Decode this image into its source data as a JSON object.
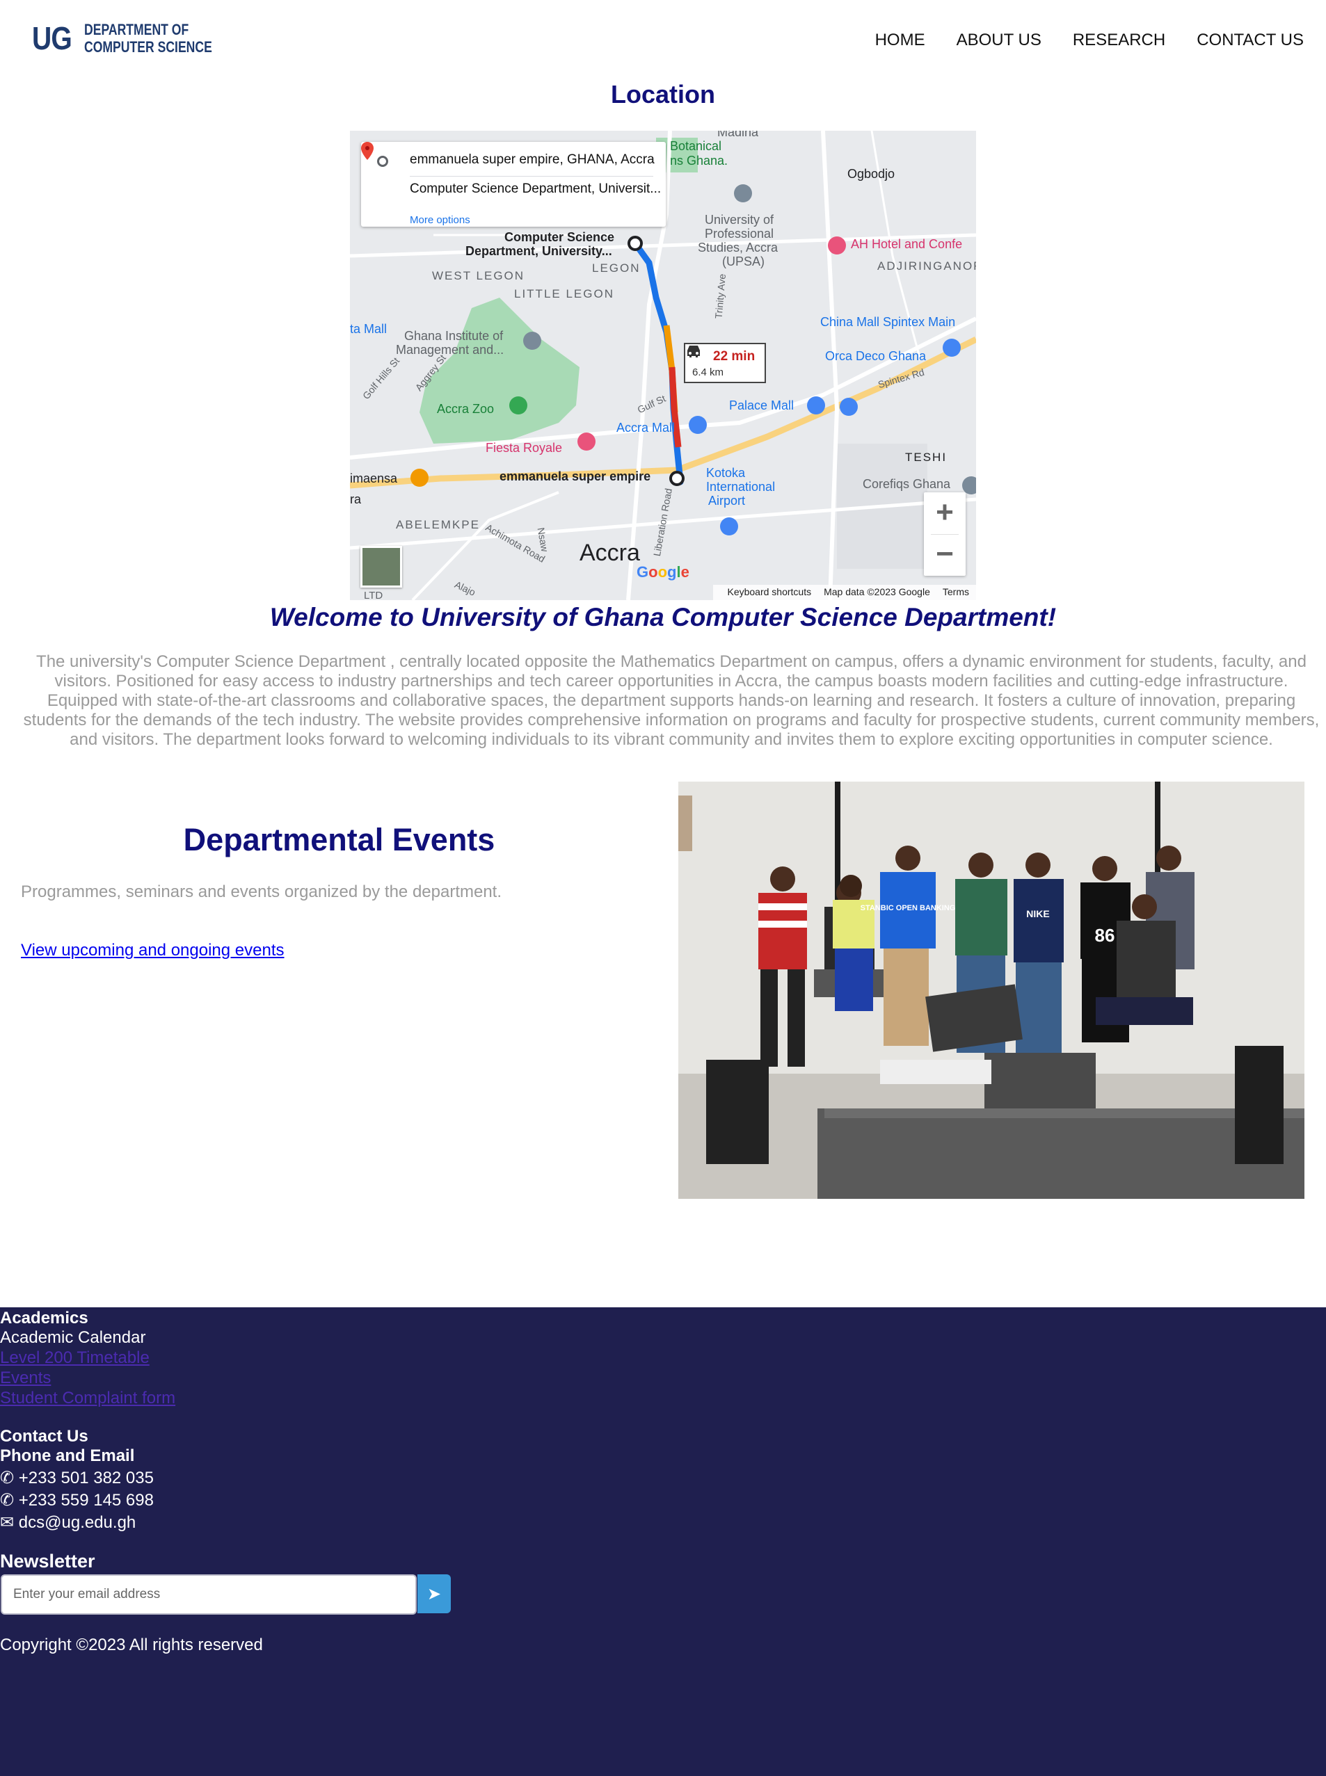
{
  "header": {
    "logo_short": "UG",
    "logo_line1": "DEPARTMENT OF",
    "logo_line2": "COMPUTER SCIENCE",
    "nav": [
      {
        "label": "HOME"
      },
      {
        "label": "ABOUT US"
      },
      {
        "label": "RESEARCH"
      },
      {
        "label": "CONTACT US"
      }
    ]
  },
  "location": {
    "title": "Location",
    "map": {
      "origin": "emmanuela super empire, GHANA, Accra",
      "destination": "Computer Science Department, Universit...",
      "more_options": "More options",
      "travel_time": "22 min",
      "distance": "6.4 km",
      "labels": {
        "madina": "Madina",
        "botanical": "Botanical",
        "botanical2": "ns Ghana.",
        "ogbodjo": "Ogbodjo",
        "upsa1": "University of",
        "upsa2": "Professional",
        "upsa3": "Studies, Accra",
        "upsa4": "(UPSA)",
        "ah_hotel": "AH Hotel and Confe",
        "adjiringanor": "ADJIRINGANOR",
        "csd1": "Computer Science",
        "csd2": "Department, University...",
        "legon": "LEGON",
        "west_legon": "WEST LEGON",
        "little_legon": "LITTLE LEGON",
        "ta_mall": "ta Mall",
        "gimpa1": "Ghana Institute of",
        "gimpa2": "Management and...",
        "china_mall": "China Mall Spintex Main",
        "orca": "Orca Deco Ghana",
        "spintex": "Spintex Rd",
        "golf_hills": "Golf Hills St",
        "aggrey": "Aggrey St",
        "accra_zoo": "Accra Zoo",
        "trinity": "Trinity Ave",
        "gulf": "Gulf St",
        "palace_mall": "Palace Mall",
        "accra_mall": "Accra Mall",
        "fiesta": "Fiesta Royale",
        "teshi": "TESHI",
        "maensa": "imaensa",
        "ra": "ra",
        "emmanuela": "emmanuela super empire",
        "kotoka1": "Kotoka",
        "kotoka2": "International",
        "kotoka3": "Airport",
        "corefiqs": "Corefiqs Ghana",
        "abelemkpe": "ABELEMKPE",
        "achimota": "Achimota Road",
        "nsawam": "Nsaw",
        "liberation": "Liberation Road",
        "accra": "Accra",
        "ltd": "LTD",
        "alajo": "Alajo"
      },
      "google": "Google",
      "footer": [
        "Keyboard shortcuts",
        "Map data ©2023 Google",
        "Terms"
      ]
    }
  },
  "welcome": {
    "title": "Welcome to University of Ghana Computer Science Department!",
    "intro": "The university's Computer Science Department , centrally located opposite the Mathematics Department on campus, offers a dynamic environment for students, faculty, and visitors. Positioned for easy access to industry partnerships and tech career opportunities in Accra, the campus boasts modern facilities and cutting-edge infrastructure. Equipped with state-of-the-art classrooms and collaborative spaces, the department supports hands-on learning and research. It fosters a culture of innovation, preparing students for the demands of the tech industry. The website provides comprehensive information on programs and faculty for prospective students, current community members, and visitors. The department looks forward to welcoming individuals to its vibrant community and invites them to explore exciting opportunities in computer science."
  },
  "events": {
    "title": "Departmental Events",
    "subtitle": "Programmes, seminars and events organized by the department.",
    "link": "View upcoming and ongoing events",
    "photo_shirt_text": "STANBIC OPEN BANKING",
    "photo_shirt_brand": "NIKE",
    "photo_shirt_number": "86"
  },
  "footer": {
    "academics_heading": "Academics",
    "academic_calendar": "Academic Calendar",
    "links": [
      "Level 200 Timetable",
      "Events",
      "Student Complaint form"
    ],
    "contact_heading": "Contact Us",
    "phone_email_heading": "Phone and Email",
    "phones": [
      "+233 501 382 035",
      "+233 559 145 698"
    ],
    "email": "dcs@ug.edu.gh",
    "newsletter_heading": "Newsletter",
    "newsletter_placeholder": "Enter your email address",
    "copyright": "Copyright ©2023 All rights reserved",
    "colors": {
      "background": "#1f1f4f",
      "button": "#3a9ad9",
      "link": "#4b2bb0"
    }
  }
}
